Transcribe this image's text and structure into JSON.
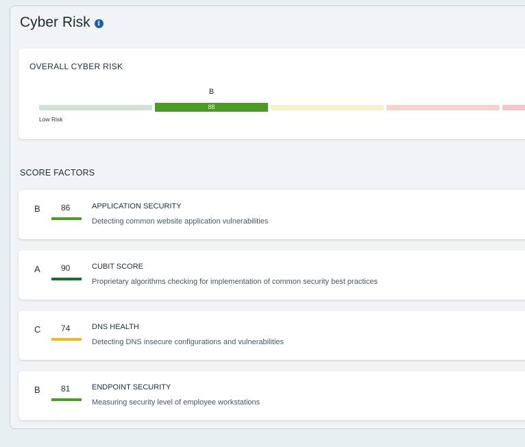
{
  "header": {
    "title": "Cyber Risk",
    "info_icon": "info-icon"
  },
  "overall": {
    "heading": "OVERALL CYBER RISK",
    "grade": "B",
    "score": "88",
    "low_label": "Low Risk",
    "segment_colors": [
      "#d1e3d8",
      "#4e9a26",
      "#f8f0cc",
      "#f6d4cc",
      "#f5c5c9"
    ]
  },
  "factors": {
    "heading": "SCORE FACTORS",
    "items": [
      {
        "grade": "B",
        "score": "86",
        "name": "APPLICATION SECURITY",
        "description": "Detecting common website application vulnerabilities",
        "color": "#4e9a26"
      },
      {
        "grade": "A",
        "score": "90",
        "name": "CUBIT SCORE",
        "description": "Proprietary algorithms checking for implementation of common security best practices",
        "color": "#1e6b2e"
      },
      {
        "grade": "C",
        "score": "74",
        "name": "DNS HEALTH",
        "description": "Detecting DNS insecure configurations and vulnerabilities",
        "color": "#f2b817"
      },
      {
        "grade": "B",
        "score": "81",
        "name": "ENDPOINT SECURITY",
        "description": "Measuring security level of employee workstations",
        "color": "#4e9a26"
      }
    ]
  }
}
